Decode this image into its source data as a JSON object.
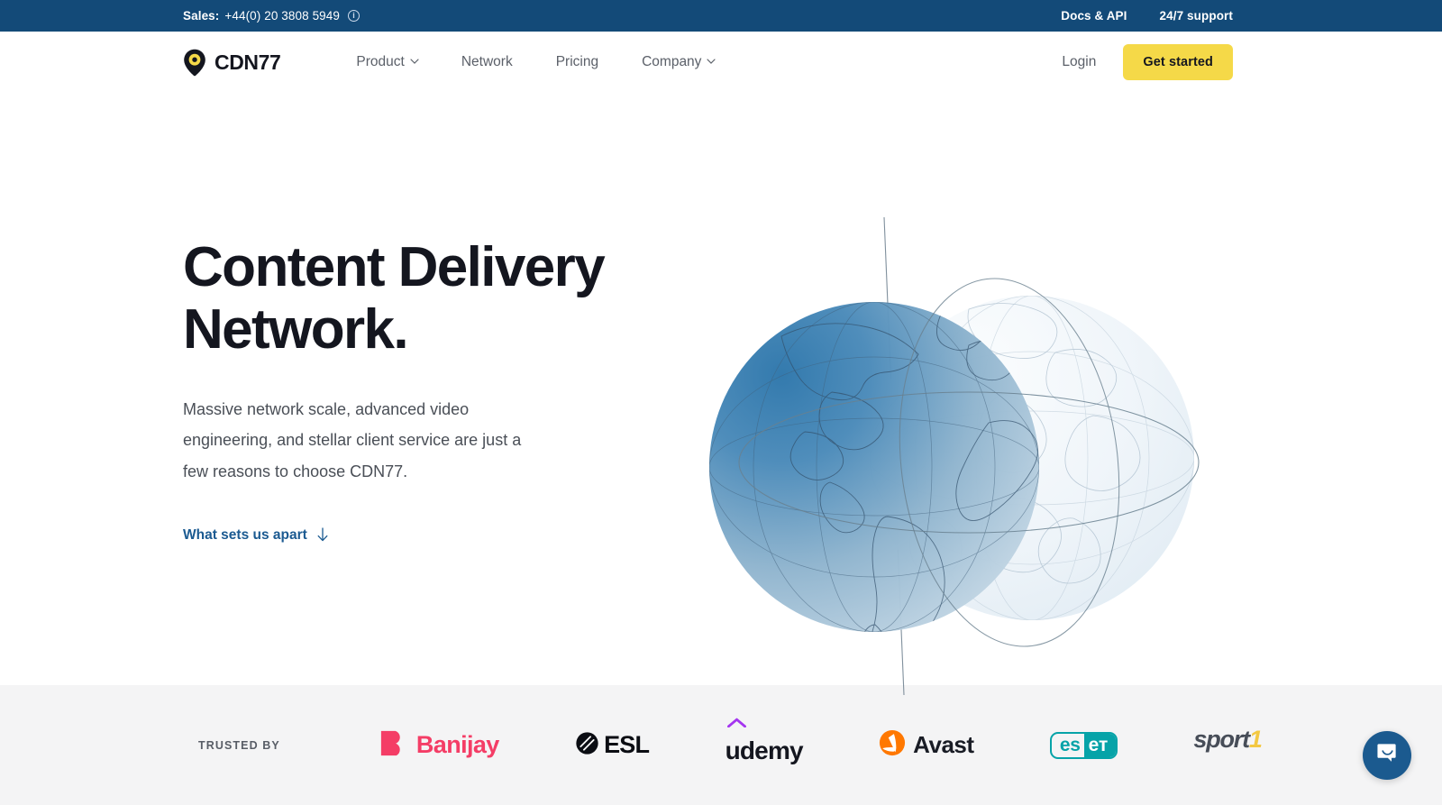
{
  "topbar": {
    "sales_label": "Sales:",
    "phone": "+44(0) 20 3808 5949",
    "info_icon": "info-circle-icon",
    "links": [
      {
        "label": "Docs & API"
      },
      {
        "label": "24/7 support"
      }
    ]
  },
  "nav": {
    "brand": "CDN77",
    "brand_icon": "map-pin-icon",
    "links": [
      {
        "label": "Product",
        "has_dropdown": true
      },
      {
        "label": "Network",
        "has_dropdown": false
      },
      {
        "label": "Pricing",
        "has_dropdown": false
      },
      {
        "label": "Company",
        "has_dropdown": true
      }
    ],
    "login_label": "Login",
    "cta_label": "Get started"
  },
  "hero": {
    "title_line1": "Content Delivery",
    "title_line2": "Network.",
    "subtitle": "Massive network scale, advanced video engineering, and stellar client service are just a few reasons to choose CDN77.",
    "link_label": "What sets us apart",
    "link_icon": "arrow-down-icon",
    "art": "globe-illustration"
  },
  "trusted": {
    "label": "TRUSTED BY",
    "logos": [
      {
        "name": "Banijay",
        "text": "Banijay",
        "color": "#f43d66"
      },
      {
        "name": "ESL",
        "text": "ESL",
        "color": "#0b0d13"
      },
      {
        "name": "Udemy",
        "text": "udemy",
        "color": "#14161f",
        "accent": "#a435f0"
      },
      {
        "name": "Avast",
        "text": "Avast",
        "color": "#191c25",
        "accent": "#ff7800"
      },
      {
        "name": "ESET",
        "text_a": "es",
        "text_b": "eт",
        "color": "#06a3a8"
      },
      {
        "name": "Sport1",
        "text": "sport",
        "text_accent": "1",
        "color": "#474d58",
        "accent": "#f3c842"
      }
    ]
  },
  "chat": {
    "icon": "chat-bubble-icon",
    "color": "#1b5a8f"
  },
  "theme": {
    "topbar_bg": "#134a78",
    "cta_yellow": "#f5d948",
    "link_blue": "#1b5a91",
    "strip_bg": "#f4f4f5",
    "text_dark": "#14161f"
  }
}
